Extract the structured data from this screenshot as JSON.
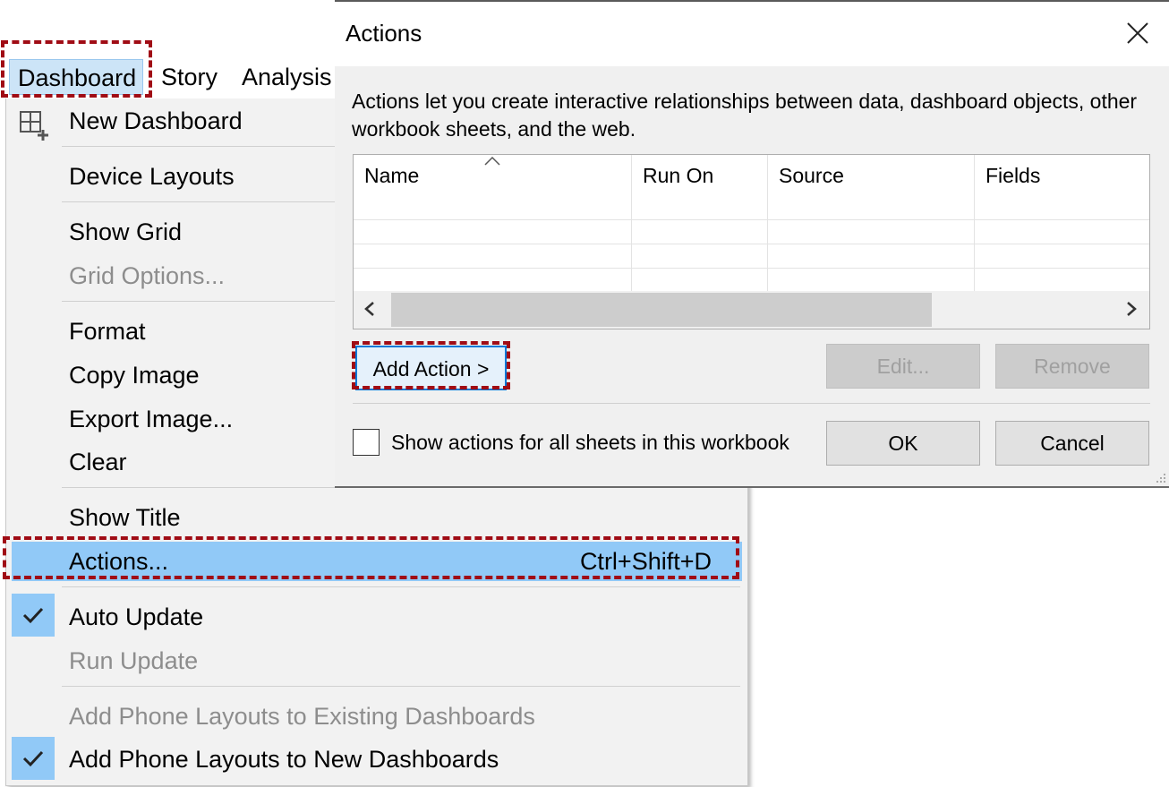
{
  "menubar": {
    "items": [
      {
        "label": "Dashboard"
      },
      {
        "label": "Story"
      },
      {
        "label": "Analysis"
      }
    ]
  },
  "dashboard_menu": {
    "new_dashboard": "New Dashboard",
    "device_layouts": "Device Layouts",
    "show_grid": "Show Grid",
    "grid_options": "Grid Options...",
    "format": "Format",
    "copy_image": "Copy Image",
    "export_image": "Export Image...",
    "clear": "Clear",
    "show_title": "Show Title",
    "actions": "Actions...",
    "actions_shortcut": "Ctrl+Shift+D",
    "auto_update": "Auto Update",
    "run_update": "Run Update",
    "add_phone_existing": "Add Phone Layouts to Existing Dashboards",
    "add_phone_new": "Add Phone Layouts to New Dashboards"
  },
  "actions_dialog": {
    "title": "Actions",
    "description": "Actions let you create interactive relationships between data, dashboard objects, other workbook sheets, and the web.",
    "columns": [
      "Name",
      "Run On",
      "Source",
      "Fields"
    ],
    "add_action_label": "Add Action >",
    "edit_label": "Edit...",
    "remove_label": "Remove",
    "show_all_label": "Show actions for all sheets in this workbook",
    "show_all_checked": false,
    "ok_label": "OK",
    "cancel_label": "Cancel"
  },
  "colors": {
    "menu_highlight": "#91c9f7",
    "annotation": "#a00c15",
    "focus_border": "#0078d7"
  }
}
